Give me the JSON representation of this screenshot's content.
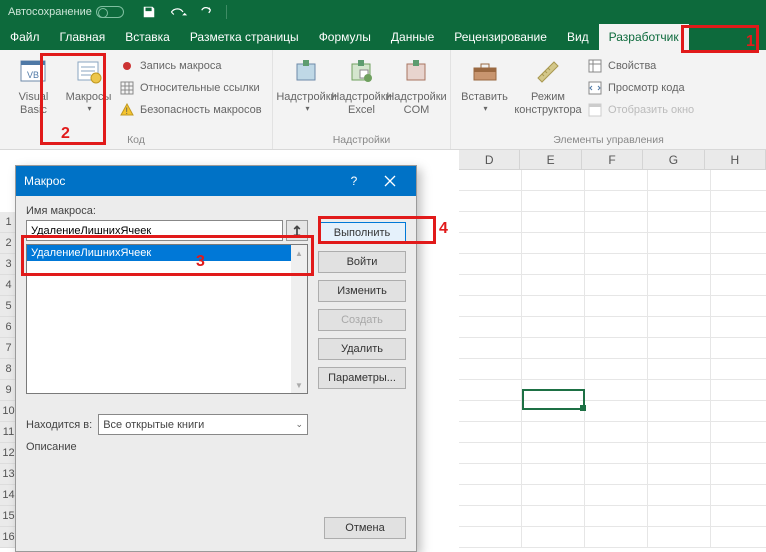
{
  "title_bar": {
    "autosave": "Автосохранение"
  },
  "tabs": [
    "Файл",
    "Главная",
    "Вставка",
    "Разметка страницы",
    "Формулы",
    "Данные",
    "Рецензирование",
    "Вид",
    "Разработчик"
  ],
  "ribbon": {
    "code": {
      "vb": "Visual\nBasic",
      "macros": "Макросы",
      "record": "Запись макроса",
      "relative": "Относительные ссылки",
      "security": "Безопасность макросов",
      "label": "Код"
    },
    "addins": {
      "addins": "Надстройки",
      "excel": "Надстройки\nExcel",
      "com": "Надстройки\nCOM",
      "label": "Надстройки"
    },
    "controls": {
      "insert": "Вставить",
      "design": "Режим\nконструктора",
      "props": "Свойства",
      "view": "Просмотр кода",
      "show": "Отобразить окно",
      "label": "Элементы управления"
    }
  },
  "columns": [
    "D",
    "E",
    "F",
    "G",
    "H"
  ],
  "rows": [
    "1",
    "2",
    "3",
    "4",
    "5",
    "6",
    "7",
    "8",
    "9",
    "10",
    "11",
    "12",
    "13",
    "14",
    "15",
    "16"
  ],
  "dialog": {
    "title": "Макрос",
    "name_label": "Имя макроса:",
    "name_value": "УдалениеЛишнихЯчеек",
    "list": [
      "УдалениеЛишнихЯчеек"
    ],
    "location_label": "Находится в:",
    "location_value": "Все открытые книги",
    "desc_label": "Описание",
    "buttons": {
      "run": "Выполнить",
      "step": "Войти",
      "edit": "Изменить",
      "create": "Создать",
      "delete": "Удалить",
      "options": "Параметры...",
      "cancel": "Отмена"
    }
  },
  "highlights": {
    "1": "1",
    "2": "2",
    "3": "3",
    "4": "4"
  }
}
